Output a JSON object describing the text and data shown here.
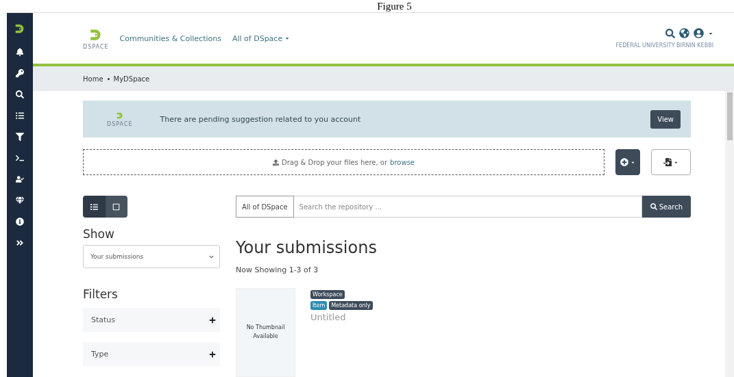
{
  "caption": "Figure 5",
  "header": {
    "logo_text": "DSPACE",
    "nav": [
      {
        "label": "Communities & Collections",
        "dropdown": false
      },
      {
        "label": "All of DSpace",
        "dropdown": true
      }
    ],
    "institution": "FEDERAL UNIVERSITY BIRNIN KEBBI"
  },
  "breadcrumb": [
    "Home",
    "MyDSpace"
  ],
  "alert": {
    "logo_text": "DSPACE",
    "text": "There are pending suggestion related to you account",
    "button": "View"
  },
  "dropzone": {
    "text": "Drag & Drop your files here, or",
    "link": "browse"
  },
  "view_toggle": [
    {
      "kind": "list",
      "selected": true
    },
    {
      "kind": "grid",
      "selected": false
    }
  ],
  "search": {
    "scope": "All of DSpace",
    "placeholder": "Search the repository ...",
    "button": "Search"
  },
  "show": {
    "label": "Show",
    "value": "Your submissions"
  },
  "filters": {
    "title": "Filters",
    "items": [
      {
        "label": "Status",
        "expanded": false
      },
      {
        "label": "Type",
        "expanded": false
      }
    ]
  },
  "results": {
    "title": "Your submissions",
    "count": "Now Showing 1-3 of 3",
    "items": [
      {
        "thumbnail": "No Thumbnail Available",
        "badges": [
          [
            {
              "label": "Workspace",
              "kind": "status"
            }
          ],
          [
            {
              "label": "Item",
              "kind": "type"
            },
            {
              "label": "Metadata only",
              "kind": "access"
            }
          ]
        ],
        "title": "Untitled"
      }
    ]
  }
}
